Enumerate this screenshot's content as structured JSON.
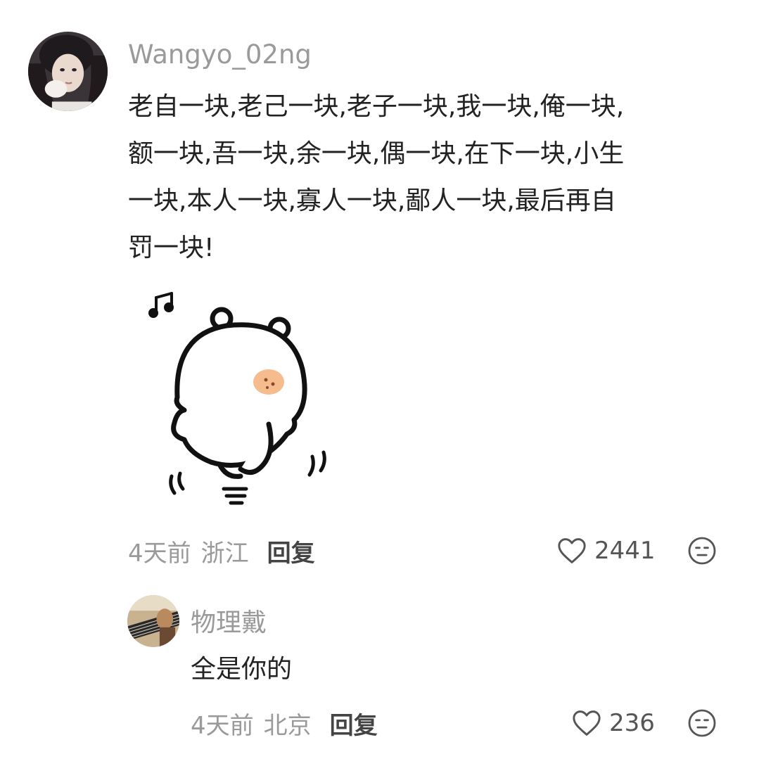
{
  "comment": {
    "username": "Wangyo_02ng",
    "text_lines": [
      "老自一块,老己一块,老子一块,我一块,俺一块,",
      "额一块,吾一块,余一块,偶一块,在下一块,小生",
      "一块,本人一块,寡人一块,鄙人一块,最后再自",
      "罚一块!"
    ],
    "time": "4天前",
    "location": "浙江",
    "reply_label": "回复",
    "likes": "2441",
    "sticker_icon": "dancing-bear-sticker"
  },
  "reply": {
    "username": "物理戴",
    "text": "全是你的",
    "time": "4天前",
    "location": "北京",
    "reply_label": "回复",
    "likes": "236"
  },
  "colors": {
    "meta_gray": "#9a9a9a",
    "reply_label": "#444444",
    "text": "#222222",
    "sticker_cheek": "#f4b07a"
  }
}
